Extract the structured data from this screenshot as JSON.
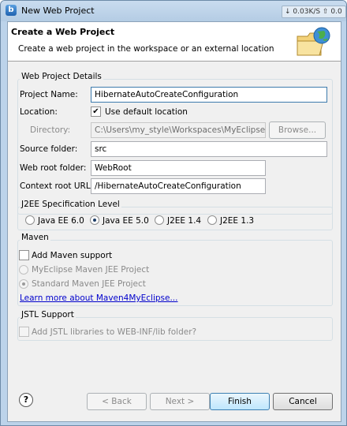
{
  "window": {
    "title": "New Web Project",
    "network_widget": "↓ 0.03K/S ⇧ 0.0"
  },
  "header": {
    "title": "Create a Web Project",
    "description": "Create a web project in the workspace or an external location"
  },
  "details": {
    "group_label": "Web Project Details",
    "project_name_label": "Project Name:",
    "project_name_value": "HibernateAutoCreateConfiguration",
    "location_label": "Location:",
    "use_default_location_label": "Use default location",
    "use_default_location_checked": true,
    "directory_label": "Directory:",
    "directory_value": "C:\\Users\\my_style\\Workspaces\\MyEclipse Blu",
    "browse_label": "Browse...",
    "source_folder_label": "Source folder:",
    "source_folder_value": "src",
    "web_root_label": "Web root folder:",
    "web_root_value": "WebRoot",
    "context_root_label": "Context root URL:",
    "context_root_value": "/HibernateAutoCreateConfiguration"
  },
  "j2ee": {
    "group_label": "J2EE Specification Level",
    "options": [
      "Java EE 6.0",
      "Java EE 5.0",
      "J2EE 1.4",
      "J2EE 1.3"
    ],
    "selected": "Java EE 5.0"
  },
  "maven": {
    "group_label": "Maven",
    "add_support_label": "Add Maven support",
    "add_support_checked": false,
    "myeclipse_jee_label": "MyEclipse Maven JEE Project",
    "standard_jee_label": "Standard Maven JEE Project",
    "learn_more_link": "Learn more about Maven4MyEclipse..."
  },
  "jstl": {
    "group_label": "JSTL Support",
    "add_jstl_label": "Add JSTL libraries to WEB-INF/lib folder?",
    "add_jstl_checked": false
  },
  "buttons": {
    "back": "< Back",
    "next": "Next >",
    "finish": "Finish",
    "cancel": "Cancel"
  },
  "icons": {
    "app": "myeclipse-icon",
    "help": "help-icon",
    "wizard": "folder-globe-icon"
  }
}
